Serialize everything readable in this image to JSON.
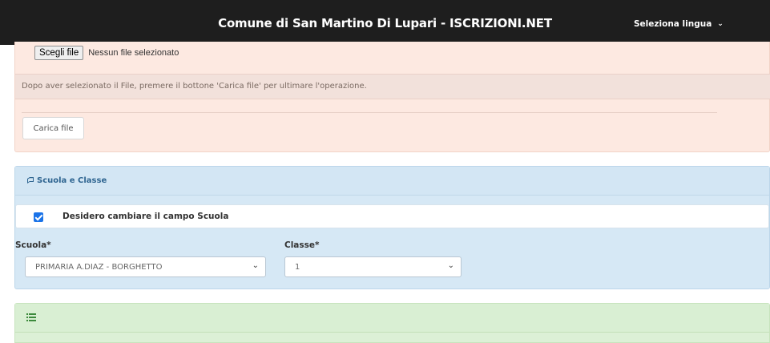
{
  "header": {
    "title": "Comune di San Martino Di Lupari - ISCRIZIONI.NET",
    "language_selector": "Seleziona lingua",
    "language_chevron": "⌄"
  },
  "upload": {
    "choose_file_label": "Scegli file",
    "file_status": "Nessun file selezionato",
    "notice": "Dopo aver selezionato il File, premere il bottone 'Carica file' per ultimare l'operazione.",
    "upload_button": "Carica file"
  },
  "school": {
    "heading_icon": "book-icon",
    "heading": "Scuola e Classe",
    "change_checkbox_label": "Desidero cambiare il campo Scuola",
    "change_checked": true,
    "school_label": "Scuola*",
    "school_value": "PRIMARIA A.DIAZ - BORGHETTO",
    "class_label": "Classe*",
    "class_value": "1",
    "caret": "⌄"
  },
  "list_panel": {
    "heading_icon": "list-icon"
  },
  "colors": {
    "topbar": "#1e1e1e",
    "upload_panel": "#fde9e1",
    "school_panel": "#d6e8f5",
    "list_panel": "#dcf0d6",
    "checkbox": "#1a73e8"
  }
}
